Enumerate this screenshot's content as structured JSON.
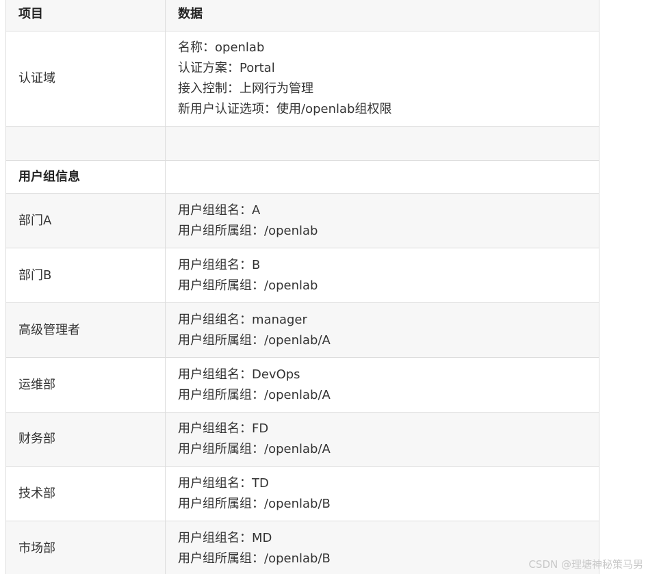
{
  "header": {
    "col1": "项目",
    "col2": "数据"
  },
  "domain_row": {
    "label": "认证域",
    "lines": [
      "名称：openlab",
      "认证方案：Portal",
      "接入控制：上网行为管理",
      "新用户认证选项：使用/openlab组权限"
    ]
  },
  "section": {
    "label": "用户组信息"
  },
  "groups": [
    {
      "label": "部门A",
      "name_line": "用户组组名：A",
      "parent_line": "用户组所属组：/openlab"
    },
    {
      "label": "部门B",
      "name_line": "用户组组名：B",
      "parent_line": "用户组所属组：/openlab"
    },
    {
      "label": "高级管理者",
      "name_line": "用户组组名：manager",
      "parent_line": "用户组所属组：/openlab/A"
    },
    {
      "label": "运维部",
      "name_line": "用户组组名：DevOps",
      "parent_line": "用户组所属组：/openlab/A"
    },
    {
      "label": "财务部",
      "name_line": "用户组组名：FD",
      "parent_line": "用户组所属组：/openlab/A"
    },
    {
      "label": "技术部",
      "name_line": "用户组组名：TD",
      "parent_line": "用户组所属组：/openlab/B"
    },
    {
      "label": "市场部",
      "name_line": "用户组组名：MD",
      "parent_line": "用户组所属组：/openlab/B"
    }
  ],
  "watermark": "CSDN @理塘神秘策马男"
}
